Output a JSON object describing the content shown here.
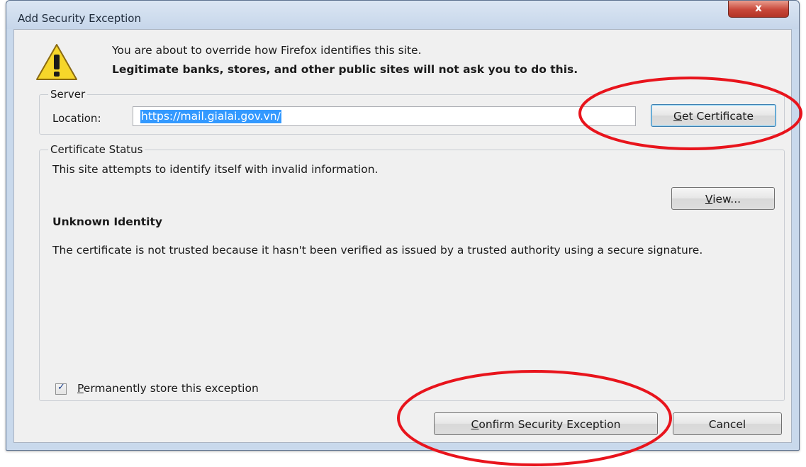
{
  "window": {
    "title": "Add Security Exception",
    "close_glyph": "x"
  },
  "intro": {
    "line1": "You are about to override how Firefox identifies this site.",
    "line2": "Legitimate banks, stores, and other public sites will not ask you to do this."
  },
  "server": {
    "group_label": "Server",
    "location_label": "Location:",
    "location_value": "https://mail.gialai.gov.vn/",
    "get_certificate_label": "Get Certificate",
    "get_certificate_mnemonic": "G",
    "get_certificate_rest": "et Certificate"
  },
  "certificate_status": {
    "group_label": "Certificate Status",
    "status_text": "This site attempts to identify itself with invalid information.",
    "view_button_mnemonic": "V",
    "view_button_rest": "iew...",
    "identity_heading": "Unknown Identity",
    "explanation": "The certificate is not trusted because it hasn't been verified as issued by a trusted authority using a secure signature."
  },
  "permanent": {
    "checked": true,
    "label_mnemonic": "P",
    "label_rest": "ermanently store this exception"
  },
  "buttons": {
    "confirm_mnemonic": "C",
    "confirm_rest": "onfirm Security Exception",
    "cancel_label": "Cancel"
  },
  "colors": {
    "annotation": "#e8141c",
    "selection": "#3399ff"
  },
  "icons": {
    "warning": "warning-triangle-icon",
    "checkbox": "check-icon"
  }
}
